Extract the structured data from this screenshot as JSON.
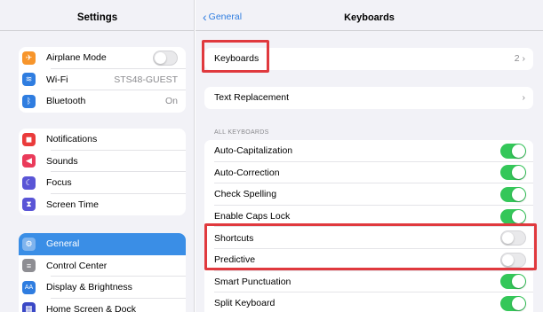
{
  "sidebar": {
    "title": "Settings",
    "groups": [
      [
        {
          "label": "Airplane Mode",
          "icon": "airplane-icon",
          "color": "#f7952b",
          "glyph": "✈"
        },
        {
          "label": "Wi-Fi",
          "value": "STS48-GUEST",
          "icon": "wifi-icon",
          "color": "#2f7de0",
          "glyph": "≋"
        },
        {
          "label": "Bluetooth",
          "value": "On",
          "icon": "bluetooth-icon",
          "color": "#2f7de0",
          "glyph": "ᛒ"
        }
      ],
      [
        {
          "label": "Notifications",
          "icon": "notifications-icon",
          "color": "#ea3b3b",
          "glyph": "◼"
        },
        {
          "label": "Sounds",
          "icon": "sounds-icon",
          "color": "#ea3b5a",
          "glyph": "◀"
        },
        {
          "label": "Focus",
          "icon": "focus-icon",
          "color": "#5a55d6",
          "glyph": "☾"
        },
        {
          "label": "Screen Time",
          "icon": "screen-time-icon",
          "color": "#5a55d6",
          "glyph": "⧗"
        }
      ],
      [
        {
          "label": "General",
          "icon": "gear-icon",
          "color": "#8e8e93",
          "glyph": "⚙"
        },
        {
          "label": "Control Center",
          "icon": "control-center-icon",
          "color": "#8e8e93",
          "glyph": "≡"
        },
        {
          "label": "Display & Brightness",
          "icon": "display-icon",
          "color": "#2f7de0",
          "glyph": "AA"
        },
        {
          "label": "Home Screen & Dock",
          "icon": "home-screen-icon",
          "color": "#3a48c6",
          "glyph": "▦"
        }
      ]
    ]
  },
  "main": {
    "back_label": "General",
    "title": "Keyboards",
    "keyboards_row": {
      "label": "Keyboards",
      "value": "2"
    },
    "text_replacement": {
      "label": "Text Replacement"
    },
    "section_header": "ALL KEYBOARDS",
    "toggles": [
      {
        "label": "Auto-Capitalization",
        "on": true
      },
      {
        "label": "Auto-Correction",
        "on": true
      },
      {
        "label": "Check Spelling",
        "on": true
      },
      {
        "label": "Enable Caps Lock",
        "on": true
      },
      {
        "label": "Shortcuts",
        "on": false
      },
      {
        "label": "Predictive",
        "on": false
      },
      {
        "label": "Smart Punctuation",
        "on": true
      },
      {
        "label": "Split Keyboard",
        "on": true
      }
    ]
  },
  "colors": {
    "accent": "#2f7de0",
    "toggle_on": "#34c759",
    "highlight": "#e0393e",
    "selected_row": "#3a8ee6"
  }
}
